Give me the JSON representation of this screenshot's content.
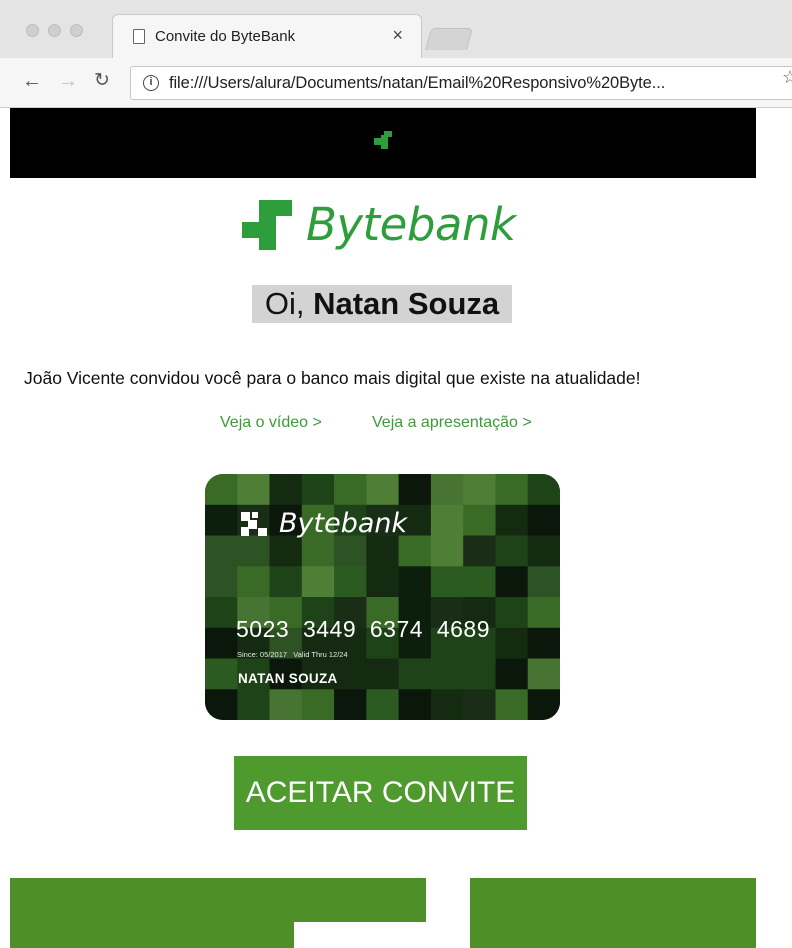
{
  "browser": {
    "tab_title": "Convite do ByteBank",
    "tab_close": "×",
    "url": "file:///Users/alura/Documents/natan/Email%20Responsivo%20Byte...",
    "icons": [
      "back-arrow-icon",
      "forward-arrow-icon",
      "reload-icon",
      "info-icon",
      "star-icon",
      "page-icon"
    ]
  },
  "email": {
    "brand_name": "Bytebank",
    "greeting_prefix": "Oi, ",
    "greeting_name": "Natan Souza",
    "invite_text": "João Vicente convidou você para o banco mais digital que existe na atualidade!",
    "links": {
      "video": "Veja o vídeo >",
      "presentation": "Veja a apresentação >"
    },
    "card": {
      "brand": "Bytebank",
      "number": "5023  3449  6374  4689",
      "dates": "Since: 05/2017   Valid Thru 12/24",
      "holder": "NATAN SOUZA"
    },
    "cta_label": "ACEITAR CONVITE"
  },
  "colors": {
    "brand_green": "#2e9e3c",
    "link_green": "#3e9a3a",
    "button_green": "#4f9a2e",
    "header_black": "#000000",
    "greeting_bg": "#d3d3d3"
  }
}
